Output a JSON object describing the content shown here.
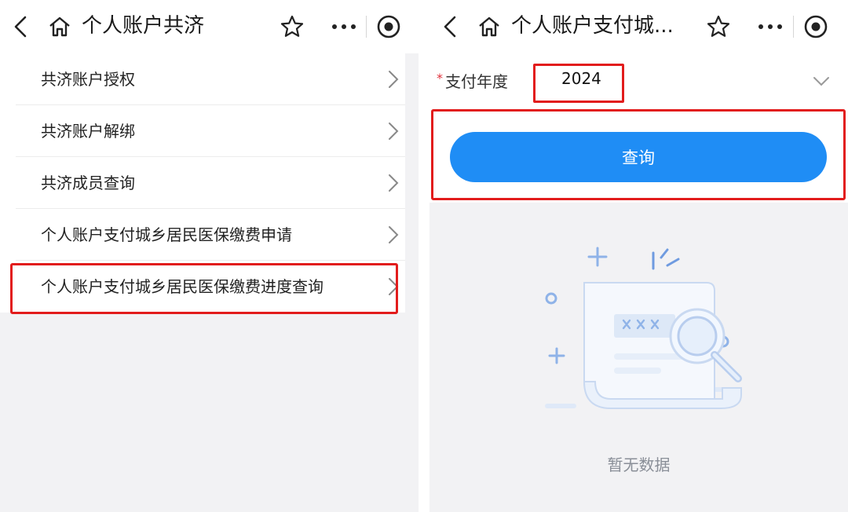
{
  "left_screen": {
    "title": "个人账户共济",
    "items": [
      {
        "label": "共济账户授权"
      },
      {
        "label": "共济账户解绑"
      },
      {
        "label": "共济成员查询"
      },
      {
        "label": "个人账户支付城乡居民医保缴费申请"
      },
      {
        "label": "个人账户支付城乡居民医保缴费进度查询"
      }
    ]
  },
  "right_screen": {
    "title": "个人账户支付城...",
    "form": {
      "required_mark": "*",
      "year_label": "支付年度",
      "year_value": "2024"
    },
    "query_button": "查询",
    "empty_text": "暂无数据"
  },
  "colors": {
    "accent": "#1f8df5",
    "highlight": "#e21c1c",
    "required": "#e0313b"
  },
  "icons": [
    "back-arrow-icon",
    "home-icon",
    "star-icon",
    "more-icon",
    "target-icon",
    "chevron-right-icon",
    "chevron-down-icon"
  ]
}
